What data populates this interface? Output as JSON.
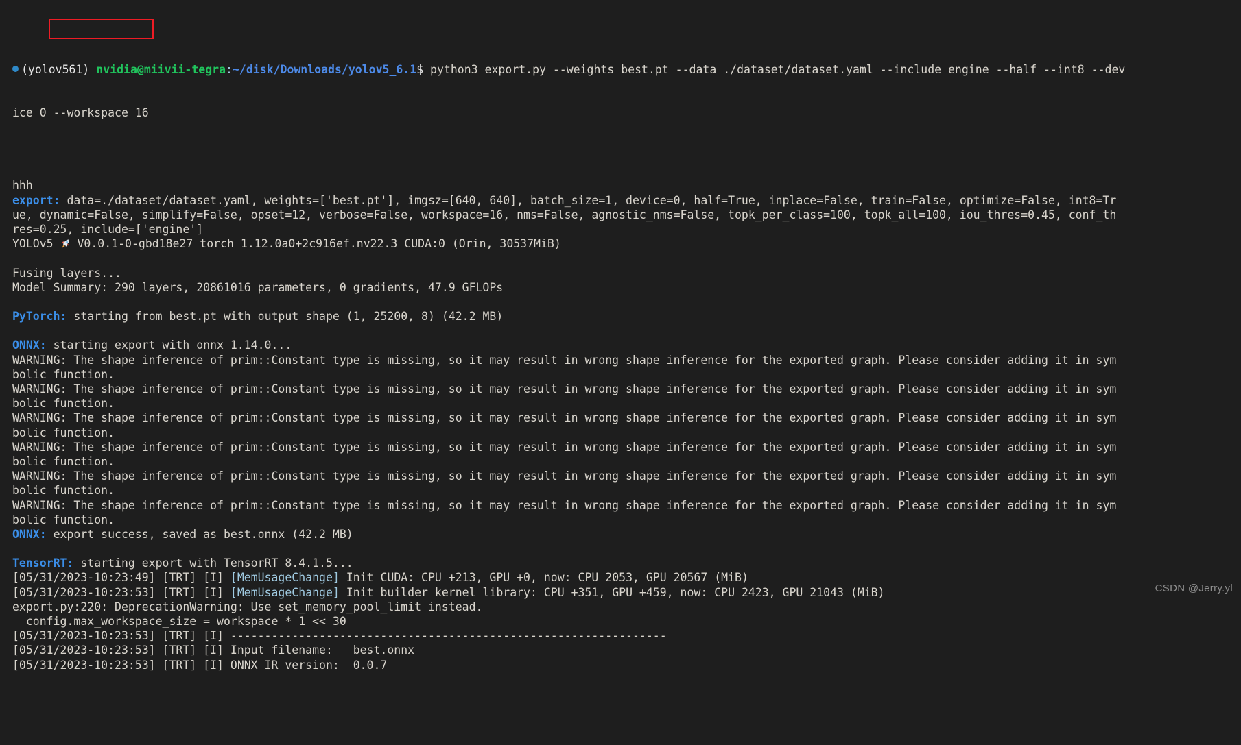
{
  "terminal": {
    "background_color": "#1e1e1e",
    "foreground_color": "#d4d4d4",
    "prompt": {
      "bullet_icon": "status-dot-icon",
      "venv": "(yolov561)",
      "user_host": "nvidia@miivii-tegra",
      "separator": ":",
      "path": "~/disk/Downloads/yolov5_6.1",
      "sigil": "$",
      "command": " python3 export.py --weights best.pt --data ./dataset/dataset.yaml --include engine --half --int8 --dev",
      "command_wrap": "ice 0 ",
      "command_highlight": "--workspace 16"
    },
    "highlight_color": "#ee1c25",
    "lines": [
      {
        "type": "plain",
        "text": "hhh"
      },
      {
        "type": "label",
        "label": "export:",
        "text": " data=./dataset/dataset.yaml, weights=['best.pt'], imgsz=[640, 640], batch_size=1, device=0, half=True, inplace=False, train=False, optimize=False, int8=Tr"
      },
      {
        "type": "plain",
        "text": "ue, dynamic=False, simplify=False, opset=12, verbose=False, workspace=16, nms=False, agnostic_nms=False, topk_per_class=100, topk_all=100, iou_thres=0.45, conf_th"
      },
      {
        "type": "plain",
        "text": "res=0.25, include=['engine']"
      },
      {
        "type": "yolo",
        "prefix": "YOLOv5 ",
        "icon": "rocket-icon",
        "text": " V0.0.1-0-gbd18e27 torch 1.12.0a0+2c916ef.nv22.3 CUDA:0 (Orin, 30537MiB)"
      },
      {
        "type": "blank"
      },
      {
        "type": "plain",
        "text": "Fusing layers..."
      },
      {
        "type": "plain",
        "text": "Model Summary: 290 layers, 20861016 parameters, 0 gradients, 47.9 GFLOPs"
      },
      {
        "type": "blank"
      },
      {
        "type": "label",
        "label": "PyTorch:",
        "text": " starting from best.pt with output shape (1, 25200, 8) (42.2 MB)"
      },
      {
        "type": "blank"
      },
      {
        "type": "label",
        "label": "ONNX:",
        "text": " starting export with onnx 1.14.0..."
      },
      {
        "type": "plain",
        "text": "WARNING: The shape inference of prim::Constant type is missing, so it may result in wrong shape inference for the exported graph. Please consider adding it in sym"
      },
      {
        "type": "plain",
        "text": "bolic function."
      },
      {
        "type": "plain",
        "text": "WARNING: The shape inference of prim::Constant type is missing, so it may result in wrong shape inference for the exported graph. Please consider adding it in sym"
      },
      {
        "type": "plain",
        "text": "bolic function."
      },
      {
        "type": "plain",
        "text": "WARNING: The shape inference of prim::Constant type is missing, so it may result in wrong shape inference for the exported graph. Please consider adding it in sym"
      },
      {
        "type": "plain",
        "text": "bolic function."
      },
      {
        "type": "plain",
        "text": "WARNING: The shape inference of prim::Constant type is missing, so it may result in wrong shape inference for the exported graph. Please consider adding it in sym"
      },
      {
        "type": "plain",
        "text": "bolic function."
      },
      {
        "type": "plain",
        "text": "WARNING: The shape inference of prim::Constant type is missing, so it may result in wrong shape inference for the exported graph. Please consider adding it in sym"
      },
      {
        "type": "plain",
        "text": "bolic function."
      },
      {
        "type": "plain",
        "text": "WARNING: The shape inference of prim::Constant type is missing, so it may result in wrong shape inference for the exported graph. Please consider adding it in sym"
      },
      {
        "type": "plain",
        "text": "bolic function."
      },
      {
        "type": "label",
        "label": "ONNX:",
        "text": " export success, saved as best.onnx (42.2 MB)"
      },
      {
        "type": "blank"
      },
      {
        "type": "label",
        "label": "TensorRT:",
        "text": " starting export with TensorRT 8.4.1.5..."
      },
      {
        "type": "trt",
        "stamp": "[05/31/2023-10:23:49] [TRT] [I] ",
        "tag": "[MemUsageChange]",
        "text": " Init CUDA: CPU +213, GPU +0, now: CPU 2053, GPU 20567 (MiB)"
      },
      {
        "type": "trt",
        "stamp": "[05/31/2023-10:23:53] [TRT] [I] ",
        "tag": "[MemUsageChange]",
        "text": " Init builder kernel library: CPU +351, GPU +459, now: CPU 2423, GPU 21043 (MiB)"
      },
      {
        "type": "plain",
        "text": "export.py:220: DeprecationWarning: Use set_memory_pool_limit instead."
      },
      {
        "type": "plain",
        "text": "  config.max_workspace_size = workspace * 1 << 30"
      },
      {
        "type": "plain",
        "text": "[05/31/2023-10:23:53] [TRT] [I] ----------------------------------------------------------------"
      },
      {
        "type": "plain",
        "text": "[05/31/2023-10:23:53] [TRT] [I] Input filename:   best.onnx"
      },
      {
        "type": "plain",
        "text": "[05/31/2023-10:23:53] [TRT] [I] ONNX IR version:  0.0.7"
      }
    ]
  },
  "watermark": {
    "text": "CSDN @Jerry.yl"
  }
}
